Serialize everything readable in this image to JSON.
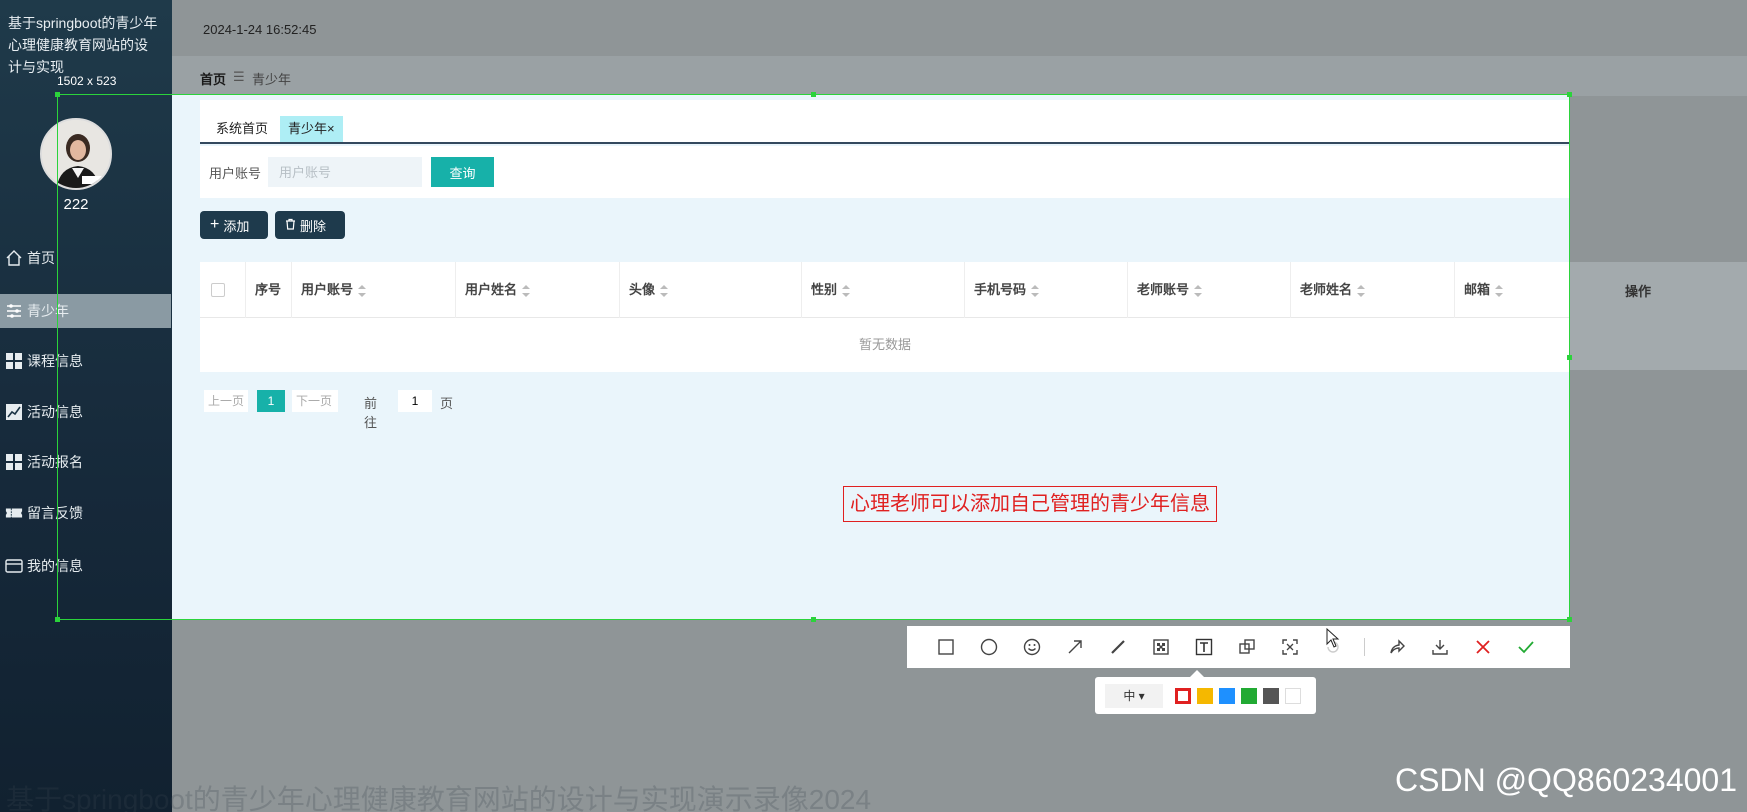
{
  "app": {
    "title": "基于springboot的青少年心理健康教育网站的设计与实现",
    "datetime": "2024-1-24 16:52:45"
  },
  "selection": {
    "size_label": "1502 x 523"
  },
  "user": {
    "name": "222"
  },
  "sidebar": {
    "items": [
      {
        "label": "首页",
        "icon": "home-icon"
      },
      {
        "label": "青少年",
        "icon": "sliders-icon",
        "active": true
      },
      {
        "label": "课程信息",
        "icon": "grid-icon"
      },
      {
        "label": "活动信息",
        "icon": "chart-icon"
      },
      {
        "label": "活动报名",
        "icon": "grid-icon"
      },
      {
        "label": "留言反馈",
        "icon": "ticket-icon"
      },
      {
        "label": "我的信息",
        "icon": "card-icon"
      }
    ]
  },
  "breadcrumb": {
    "home": "首页",
    "separator": "☰",
    "current": "青少年"
  },
  "tabs": [
    {
      "label": "系统首页"
    },
    {
      "label": "青少年×",
      "active": true
    }
  ],
  "search": {
    "label": "用户账号",
    "placeholder": "用户账号",
    "button": "查询"
  },
  "actions": {
    "add": "添加",
    "delete": "删除"
  },
  "table": {
    "columns": [
      "序号",
      "用户账号",
      "用户姓名",
      "头像",
      "性别",
      "手机号码",
      "老师账号",
      "老师姓名",
      "邮箱",
      "操作"
    ],
    "empty_text": "暂无数据"
  },
  "pager": {
    "prev": "上一页",
    "current": "1",
    "next": "下一页",
    "goto_label": "前往",
    "goto_value": "1",
    "suffix": "页"
  },
  "annotation": {
    "text": "心理老师可以添加自己管理的青少年信息"
  },
  "toolbar": {
    "tools": [
      "rectangle-icon",
      "circle-icon",
      "emoji-icon",
      "arrow-icon",
      "pen-icon",
      "mosaic-icon",
      "text-icon",
      "pin-icon",
      "ocr-icon",
      "undo-icon",
      "share-icon",
      "save-icon",
      "cancel-icon",
      "confirm-icon"
    ],
    "size": "中",
    "colors": [
      "#e02020",
      "#f5b800",
      "#1e90ff",
      "#22aa33",
      "#555555",
      "#ffffff"
    ]
  },
  "watermark": {
    "left": "基于springboot的青少年心理健康教育网站的设计与实现演示录像2024",
    "right": "CSDN @QQ860234001"
  }
}
